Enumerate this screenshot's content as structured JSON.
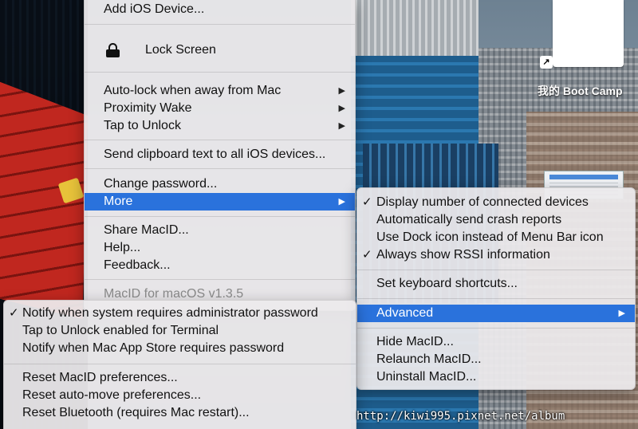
{
  "desktop": {
    "file_label": "我的 Boot Camp"
  },
  "main_menu": {
    "items": {
      "add_ios": "Add iOS Device...",
      "lock_screen": "Lock Screen",
      "auto_lock": "Auto-lock when away from Mac",
      "proximity": "Proximity Wake",
      "tap_unlock": "Tap to Unlock",
      "send_clipboard": "Send clipboard text to all iOS devices...",
      "change_password": "Change password...",
      "more": "More",
      "share": "Share MacID...",
      "help": "Help...",
      "feedback": "Feedback...",
      "version": "MacID for macOS v1.3.5"
    }
  },
  "more_menu": {
    "items": {
      "display_count": "Display number of connected devices",
      "crash_reports": "Automatically send crash reports",
      "dock_icon": "Use Dock icon instead of Menu Bar icon",
      "rssi": "Always show RSSI information",
      "shortcuts": "Set keyboard shortcuts...",
      "advanced": "Advanced",
      "hide": "Hide MacID...",
      "relaunch": "Relaunch MacID...",
      "uninstall": "Uninstall MacID..."
    },
    "checked": {
      "display_count": true,
      "crash_reports": false,
      "dock_icon": false,
      "rssi": true
    }
  },
  "advanced_menu": {
    "items": {
      "notify_admin": "Notify when system requires administrator password",
      "tap_terminal": "Tap to Unlock enabled for Terminal",
      "notify_appstore": "Notify when Mac App Store requires password",
      "reset_prefs": "Reset MacID preferences...",
      "reset_automove": "Reset auto-move preferences...",
      "reset_bt": "Reset Bluetooth (requires Mac restart)..."
    },
    "checked": {
      "notify_admin": true
    }
  },
  "glyphs": {
    "check": "✓",
    "submenu_arrow": "▶",
    "alias_arrow": "↗"
  },
  "colors": {
    "highlight": "#2a72dc",
    "menu_bg": "#eceaec"
  },
  "watermark": "http://kiwi995.pixnet.net/album"
}
